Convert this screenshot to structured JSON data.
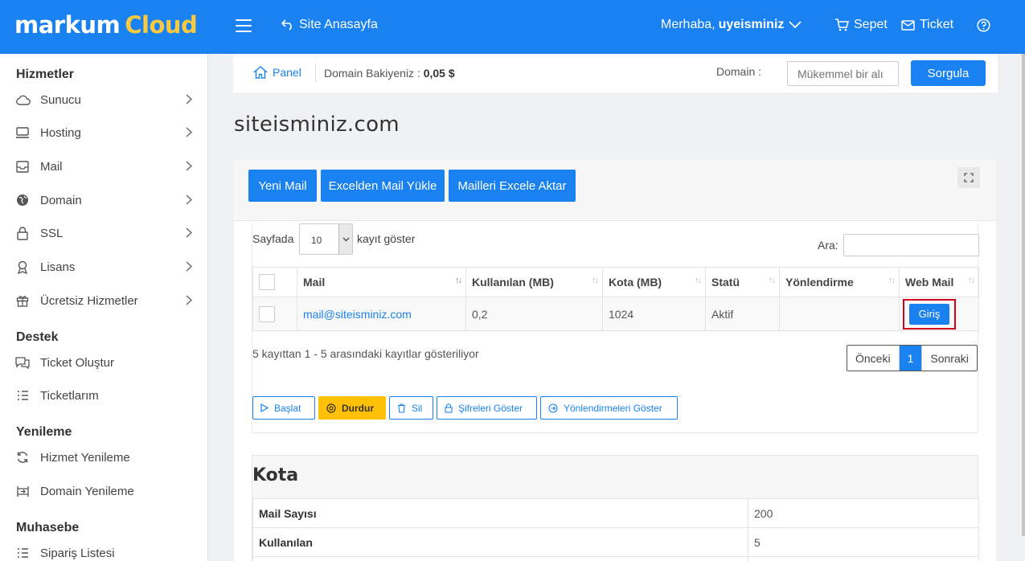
{
  "topbar": {
    "logo_main": "markum",
    "logo_accent": "Cloud",
    "home_link": "Site Anasayfa",
    "greeting": "Merhaba,",
    "username": "uyeisminiz",
    "cart": "Sepet",
    "ticket": "Ticket"
  },
  "sidebar": {
    "sections": [
      {
        "title": "Hizmetler"
      },
      {
        "title": "Destek"
      },
      {
        "title": "Yenileme"
      },
      {
        "title": "Muhasebe"
      }
    ],
    "items": [
      {
        "label": "Sunucu",
        "icon": "cloud-icon"
      },
      {
        "label": "Hosting",
        "icon": "hosting-icon"
      },
      {
        "label": "Mail",
        "icon": "mail-icon"
      },
      {
        "label": "Domain",
        "icon": "globe-icon"
      },
      {
        "label": "SSL",
        "icon": "lock-icon"
      },
      {
        "label": "Lisans",
        "icon": "license-icon"
      },
      {
        "label": "Ücretsiz Hizmetler",
        "icon": "gift-icon"
      },
      {
        "label": "Ticket Oluştur",
        "icon": "chat-icon"
      },
      {
        "label": "Ticketlarım",
        "icon": "list-icon"
      },
      {
        "label": "Hizmet Yenileme",
        "icon": "refresh-icon"
      },
      {
        "label": "Domain Yenileme",
        "icon": "domain-renew-icon"
      },
      {
        "label": "Sipariş Listesi",
        "icon": "order-list-icon"
      }
    ]
  },
  "subheader": {
    "panel": "Panel",
    "balance_label": "Domain Bakiyeniz :",
    "balance_value": "0,05 $",
    "domain_label": "Domain :",
    "domain_placeholder": "Mükemmel bir alı",
    "query_button": "Sorgula"
  },
  "page": {
    "title": "siteisminiz.com"
  },
  "toolbar": {
    "new_mail": "Yeni Mail",
    "import_excel": "Excelden Mail Yükle",
    "export_excel": "Mailleri Excele Aktar"
  },
  "table_controls": {
    "show_prefix": "Sayfada",
    "page_size": "10",
    "show_suffix": "kayıt göster",
    "search_label": "Ara:"
  },
  "mail_table": {
    "columns": [
      "Mail",
      "Kullanılan (MB)",
      "Kota (MB)",
      "Statü",
      "Yönlendirme",
      "Web Mail"
    ],
    "rows": [
      {
        "mail": "mail@siteisminiz.com",
        "used": "0,2",
        "quota": "1024",
        "status": "Aktif",
        "redirect": "",
        "webmail_button": "Giriş"
      }
    ]
  },
  "pagination": {
    "info": "5 kayıttan 1 - 5 arasındaki kayıtlar gösteriliyor",
    "prev": "Önceki",
    "current": "1",
    "next": "Sonraki"
  },
  "actions": {
    "start": "Başlat",
    "stop": "Durdur",
    "delete": "Sil",
    "show_passwords": "Şifreleri Göster",
    "show_redirects": "Yönlendirmeleri Göster"
  },
  "quota": {
    "title": "Kota",
    "rows": [
      {
        "label": "Mail Sayısı",
        "value": "200"
      },
      {
        "label": "Kullanılan",
        "value": "5"
      }
    ]
  },
  "colors": {
    "primary": "#1a82f0",
    "accent": "#f9c941",
    "warning": "#ffc107",
    "highlight": "#d0021b"
  }
}
